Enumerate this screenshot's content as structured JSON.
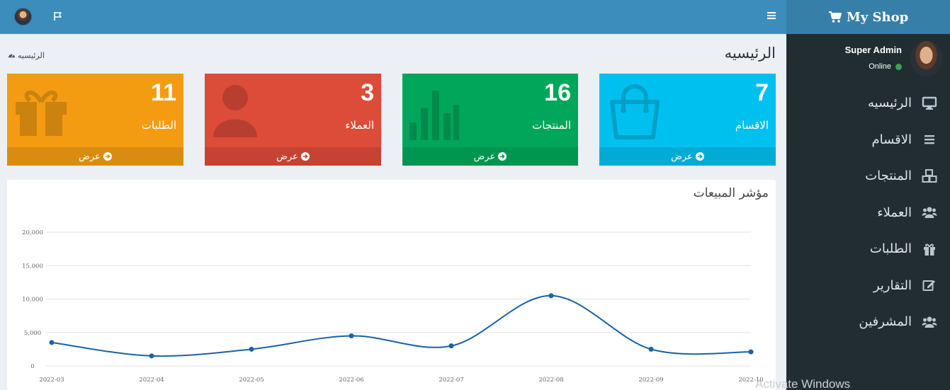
{
  "header": {
    "logo_text": "My Shop"
  },
  "user": {
    "name": "Super Admin",
    "status": "Online"
  },
  "sidebar": {
    "items": [
      {
        "label": "الرئيسيه",
        "icon": "desktop-icon"
      },
      {
        "label": "الاقسام",
        "icon": "bars-icon"
      },
      {
        "label": "المنتجات",
        "icon": "cubes-icon"
      },
      {
        "label": "العملاء",
        "icon": "users-icon"
      },
      {
        "label": "الطلبات",
        "icon": "gift-icon"
      },
      {
        "label": "التقارير",
        "icon": "edit-icon"
      },
      {
        "label": "المشرفين",
        "icon": "users-icon"
      }
    ]
  },
  "page": {
    "title": "الرئيسيه",
    "breadcrumb": "الرئيسيه"
  },
  "boxes": [
    {
      "count": "7",
      "label": "الاقسام",
      "link": "عرض",
      "color": "#00c0ef",
      "icon": "shopping-bag-icon"
    },
    {
      "count": "16",
      "label": "المنتجات",
      "link": "عرض",
      "color": "#00a65a",
      "icon": "bar-chart-icon"
    },
    {
      "count": "3",
      "label": "العملاء",
      "link": "عرض",
      "color": "#dd4b39",
      "icon": "user-icon"
    },
    {
      "count": "11",
      "label": "الطلبات",
      "link": "عرض",
      "color": "#f39c12",
      "icon": "gift-icon"
    }
  ],
  "chart_panel": {
    "title": "مؤشر المبيعات"
  },
  "chart_data": {
    "type": "line",
    "title": "",
    "x": [
      "2022-03",
      "2022-04",
      "2022-05",
      "2022-06",
      "2022-07",
      "2022-08",
      "2022-09",
      "2022-10"
    ],
    "series": [
      {
        "values": [
          3500,
          1500,
          2500,
          4500,
          3000,
          10500,
          2500,
          2100
        ]
      }
    ],
    "ylim": [
      0,
      20000
    ],
    "yticks": [
      "0",
      "5,000",
      "10,000",
      "15,000",
      "20,000"
    ],
    "grid": true,
    "line_color": "#1a62a5"
  },
  "watermark": "Activate Windows"
}
